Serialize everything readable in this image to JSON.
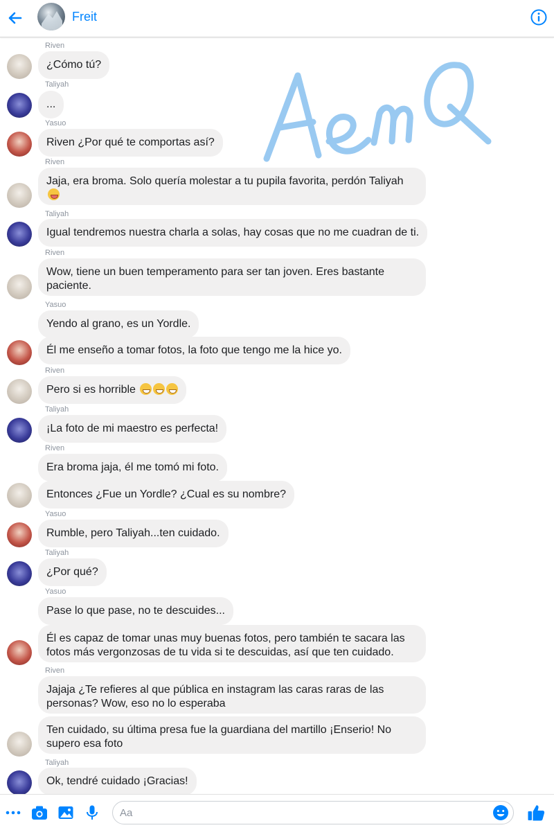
{
  "header": {
    "title": "Freit",
    "back_icon": "back-arrow-icon",
    "info_icon": "info-icon"
  },
  "watermark": "AemQ",
  "messages": [
    {
      "sender": "Riven",
      "text": "¿Cómo tú?"
    },
    {
      "sender": "Taliyah",
      "text": "..."
    },
    {
      "sender": "Yasuo",
      "text": "Riven ¿Por qué te comportas así?"
    },
    {
      "sender": "Riven",
      "text": "Jaja, era broma. Solo quería molestar a tu pupila favorita, perdón Taliyah"
    },
    {
      "sender": "Taliyah",
      "text": "Igual tendremos nuestra charla a solas, hay cosas que no me cuadran de ti."
    },
    {
      "sender": "Riven",
      "text": "Wow, tiene un buen temperamento para ser tan joven. Eres bastante paciente."
    },
    {
      "sender": "Yasuo",
      "text": "Yendo al grano, es un Yordle."
    },
    {
      "sender": "Yasuo",
      "text": "Él me enseño a tomar fotos, la foto que tengo me la hice yo."
    },
    {
      "sender": "Riven",
      "text": "Pero si es horrible"
    },
    {
      "sender": "Taliyah",
      "text": "¡La foto de mi maestro es perfecta!"
    },
    {
      "sender": "Riven",
      "text": "Era broma jaja, él me tomó mi foto."
    },
    {
      "sender": "Riven",
      "text": "Entonces ¿Fue un Yordle? ¿Cual es su nombre?"
    },
    {
      "sender": "Yasuo",
      "text": "Rumble, pero Taliyah...ten cuidado."
    },
    {
      "sender": "Taliyah",
      "text": "¿Por qué?"
    },
    {
      "sender": "Yasuo",
      "text": "Pase lo que pase, no te descuides..."
    },
    {
      "sender": "Yasuo",
      "text": "Él es capaz de tomar unas muy buenas fotos, pero también te sacara las fotos más vergonzosas de tu vida si te descuidas, así que ten cuidado."
    },
    {
      "sender": "Riven",
      "text": "Jajaja ¿Te refieres al que pública en instagram las caras raras de las personas? Wow, eso no lo esperaba"
    },
    {
      "sender": "Riven",
      "text": "Ten cuidado, su última presa fue la guardiana del martillo ¡Enserio! No supero esa foto"
    },
    {
      "sender": "Taliyah",
      "text": "Ok, tendré cuidado ¡Gracias!"
    }
  ],
  "composer": {
    "placeholder": "Aa",
    "icons": [
      "more-icon",
      "camera-icon",
      "gallery-icon",
      "microphone-icon",
      "emoji-icon",
      "like-icon"
    ]
  },
  "colors": {
    "accent": "#0084ff",
    "bubble": "#f1f0f0",
    "watermark": "#8ec4f0"
  }
}
